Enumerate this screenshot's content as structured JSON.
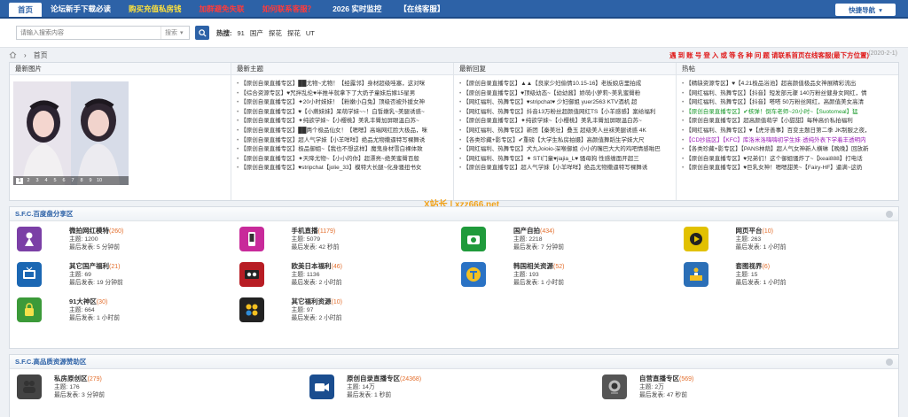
{
  "nav": {
    "items": [
      {
        "label": "首页"
      },
      {
        "label": "论坛新手下载必读"
      },
      {
        "label": "购买充值私房钱"
      },
      {
        "label": "加群避免失联"
      },
      {
        "label": "如何联系客服？"
      },
      {
        "label": "2026 实时监控"
      },
      {
        "label": "【在线客服】"
      }
    ],
    "quick_nav": "快捷导航"
  },
  "search": {
    "placeholder": "请输入搜索内容",
    "type": "搜索",
    "hot_label": "热搜:",
    "hot_items": [
      "91",
      "国产",
      "探花",
      "探花",
      "UT"
    ]
  },
  "breadcrumb": {
    "home": "首页"
  },
  "notice": {
    "text": "遇 到 账 号 登 入 或 等 各 种 问 题 请联系首页在线客服(最下方位置)",
    "date": "(2020-2-1)"
  },
  "feed": {
    "columns": [
      "最新图片",
      "最新主题",
      "最新回复",
      "热帖"
    ],
    "photo_pages": [
      "1",
      "2",
      "3",
      "4",
      "5",
      "6",
      "7",
      "8",
      "9",
      "10"
    ],
    "topics": [
      "【原创自录直播专区】██尤物~尤物！【经露邻】身材超级哇塞，这对咪",
      "【综合资源专区】♥咒拌乱伦♥半推半就拿下了大奶子童妹后嫁15星男",
      "【原创自录直播专区】✦20小时妹妹！【粉嫩小白兔】顶级否被外援女神",
      "【原创自录直播专区】♥【小蕨妹妹】呆萌学妹~~！白皙嫩乳~美腿诱惑~",
      "【原创自录直播专区】✦纯欲学妹~【小樱桃】美乳丰臀加屏眼温白苏~",
      "【原创自录直播专区】██两个极品仙女！【嗯嗯】高端网红脸大极品，咪",
      "【原创自录直播专区】超人气学妹【小羊咩咩】绝品尤物撒逼特写裸舞诱",
      "【原创自录直播专区】极品御姐~【我也不想这样】魔鬼身材雪白裸体致",
      "【原创自录直播专区】✦天降尤物~【小小的你】超漂亮~绝美蜜臀百般",
      "【原创自录直播专区】♥stripchat【jolie_33】模特大长腿~化身骚扭书女"
    ],
    "replies": [
      "【原创自录直播专区】▲▲【良家少妇偷情10.15-16】老板娘店里拍成",
      "【原创自录直播专区】♥顶级幼态~【幼幼酱】娇萌小萝莉~美乳蜜臀粉",
      "【网红福利、热舞专区】♥stripchat♥ 少妇御姐 yuer2563 KTV酒机 超",
      "【网红福利、热舞专区】抖音13万粉丝超颜值网红TS【小羊感感】案给福利",
      "【原创自录直播专区】✦纯欲学妹~【小樱桃】美乳丰臀加屏眼温白苏~",
      "【网红福利、热舞专区】新团【秦美壮】叠玉 超级美人丝袜美腿诱惑 4K",
      "【各类珍藏+影专区】✔重磅【大学生私房拍摄】高颜值舞蹈生学妹大尺",
      "【网红福利、热舞专区】犬九Joioio-深喉御姐 小小的嘴巴大大的鸡吧情感啪巴",
      "【网红福利、热舞专区】✦ STI门童♥jiajia_L♥ 骚母狗 性感缠面开超三",
      "【原创自录直播专区】超人气学妹【小羊咩咩】绝品尤物撒逼特写裸舞诱"
    ],
    "hot": [
      {
        "text": "【精缺资源专区】♥【4.21极品浴池】超高颜值极品女神展精彩流出",
        "color": "normal"
      },
      {
        "text": "【网红福利、热舞专区】【抖音】短发部元骤 140万粉丝健身女网红，情",
        "color": "normal"
      },
      {
        "text": "【网红福利、热舞专区】【抖音】嗒嗒 50万粉丝网红，高颜值美女高清",
        "color": "normal"
      },
      {
        "text": "【原创自录直播专区】✔核弹！倒车老师~20小时~【Suotomeal】猛",
        "color": "green"
      },
      {
        "text": "【原创自录直播专区】超高颜值萌学【小甜甜】每种高价私拍福利",
        "color": "normal"
      },
      {
        "text": "【网红福利、热舞专区】♥【虎牙善事】百变主题日第二季 JK制服之夜，",
        "color": "normal"
      },
      {
        "text": "【CD抄底区】【KFC】库洛米洛嗨嗨初学生妹·透纯外表下学着丰透明内",
        "color": "purple"
      },
      {
        "text": "【各类珍藏+影专区】【PANS林荫】超人气女神新人横琳【晚晚】回放新",
        "color": "normal"
      },
      {
        "text": "【原创自录直播专区】♥兄弟们！这个御姐骚炸了~【keai888】打电话",
        "color": "normal"
      },
      {
        "text": "【原创自录直播专区】♥巨乳女神！嗯嗯甜美~【Fairy-HF】逼满~这奶",
        "color": "normal"
      }
    ]
  },
  "watermark": "X站长 | xzz666.net",
  "section1": {
    "title": "S.F.C.百度盘分享区",
    "forums": [
      {
        "name": "微拍网红模特",
        "count": "(260)",
        "topics": "主题: 1200",
        "last": "最后发表: 5 分钟前",
        "icon": "doll-icon",
        "color": "#7b3fa6"
      },
      {
        "name": "手机直播",
        "count": "(1179)",
        "topics": "主题: 5079",
        "last": "最后发表: 42 秒前",
        "icon": "phone-live-icon",
        "color": "#c82a9a"
      },
      {
        "name": "国产自拍",
        "count": "(434)",
        "topics": "主题: 2218",
        "last": "最后发表: 7 分钟前",
        "icon": "camera-icon",
        "color": "#1f9a3b"
      },
      {
        "name": "网页平台",
        "count": "(10)",
        "topics": "主题: 263",
        "last": "最后发表: 1 小时前",
        "icon": "play-icon",
        "color": "#e2c100"
      },
      {
        "name": "其它国产福利",
        "count": "(21)",
        "topics": "主题: 69",
        "last": "最后发表: 19 分钟前",
        "icon": "tv-icon",
        "color": "#1b67b3"
      },
      {
        "name": "欧美日本福利",
        "count": "(46)",
        "topics": "主题: 1136",
        "last": "最后发表: 2 小时前",
        "icon": "tape-icon",
        "color": "#b81d24"
      },
      {
        "name": "韩国相关资源",
        "count": "(52)",
        "topics": "主题: 193",
        "last": "最后发表: 1 小时前",
        "icon": "badge-t-icon",
        "color": "#2a72c4"
      },
      {
        "name": "套图视界",
        "count": "(6)",
        "topics": "主题: 15",
        "last": "最后发表: 1 小时前",
        "icon": "podium-icon",
        "color": "#2b6fb7"
      },
      {
        "name": "91大神区",
        "count": "(30)",
        "topics": "主题: 664",
        "last": "最后发表: 1 小时前",
        "icon": "lock-icon",
        "color": "#3b9a39"
      },
      {
        "name": "其它福利资源",
        "count": "(10)",
        "topics": "主题: 97",
        "last": "最后发表: 2 小时前",
        "icon": "dots-icon",
        "color": "#222"
      }
    ]
  },
  "section2": {
    "title": "S.F.C.高品质资源赞助区",
    "forums": [
      {
        "name": "私房原创区",
        "count": "(279)",
        "topics": "主题: 176",
        "last": "最后发表: 3 分钟前",
        "icon": "couple-icon",
        "color": "#444"
      },
      {
        "name": "原创自录直播专区",
        "count": "(24368)",
        "topics": "主题: 14万",
        "last": "最后发表: 1 秒前",
        "icon": "video-cam-icon",
        "color": "#1a4d8f"
      },
      {
        "name": "自营直播专区",
        "count": "(569)",
        "topics": "主题: 2万",
        "last": "最后发表: 47 秒前",
        "icon": "webcam-icon",
        "color": "#555"
      }
    ]
  }
}
